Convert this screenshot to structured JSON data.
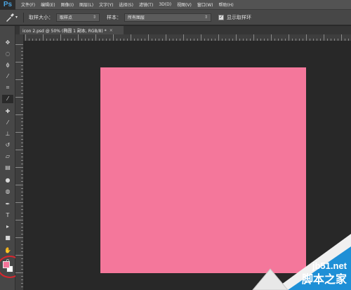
{
  "app": {
    "logo": "Ps"
  },
  "menubar": {
    "items": [
      "文件(F)",
      "编辑(E)",
      "图像(I)",
      "图层(L)",
      "文字(Y)",
      "选择(S)",
      "滤镜(T)",
      "3D(D)",
      "视图(V)",
      "窗口(W)",
      "帮助(H)"
    ]
  },
  "options": {
    "tool_icon": "eyedropper-icon",
    "sample_size_label": "取样大小：",
    "sample_size_value": "取样点",
    "sample_label": "样本：",
    "sample_value": "所有图层",
    "show_ring_label": "显示取样环",
    "show_ring_checked": true
  },
  "document": {
    "tab_title": "icon 2.psd @ 50% (椭圆 1 副本, RGB/8) *",
    "tab_close": "×",
    "canvas_color": "#f4779b"
  },
  "toolbar": {
    "tools": [
      "move-tool",
      "marquee-tool",
      "lasso-tool",
      "quick-select-tool",
      "crop-tool",
      "eyedropper-tool",
      "healing-brush-tool",
      "brush-tool",
      "clone-stamp-tool",
      "history-brush-tool",
      "eraser-tool",
      "gradient-tool",
      "blur-tool",
      "dodge-tool",
      "pen-tool",
      "type-tool",
      "path-select-tool",
      "rectangle-tool",
      "hand-tool",
      "zoom-tool"
    ],
    "foreground_color": "#f37399",
    "background_color": "#ffffff"
  },
  "watermark": {
    "line1": "jb51.net",
    "line2": "脚本之家"
  }
}
